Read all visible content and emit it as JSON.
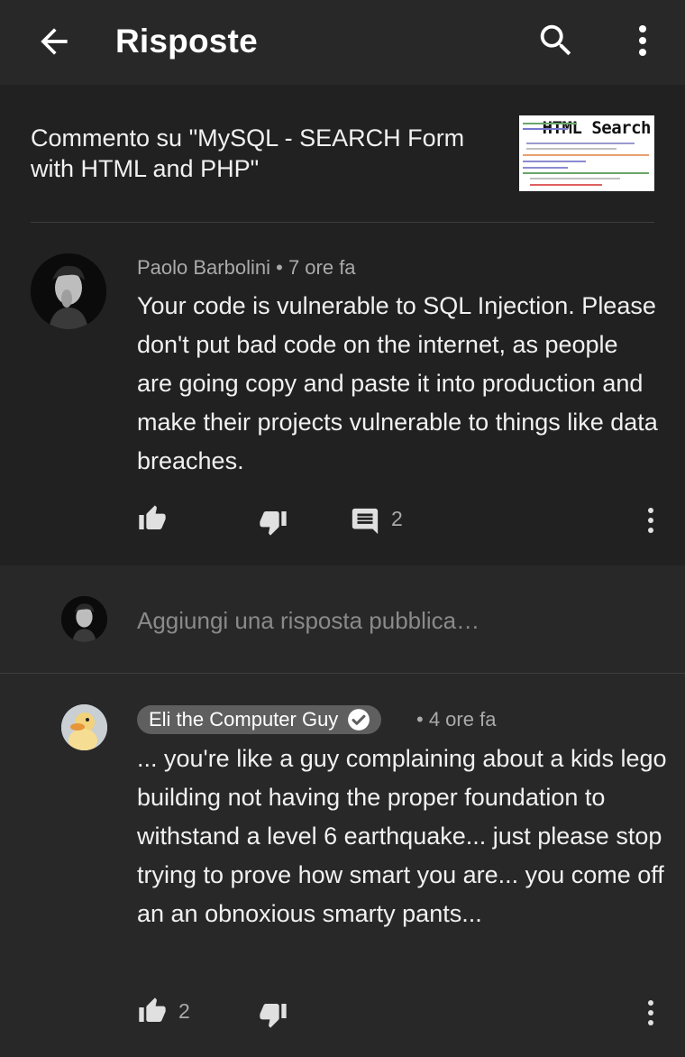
{
  "header": {
    "title": "Risposte",
    "icons": [
      "arrow-back-icon",
      "search-icon",
      "more-vert-icon"
    ]
  },
  "context": {
    "text": "Commento su \"MySQL - SEARCH Form with HTML and PHP\"",
    "thumbnail_text": "HTML Search"
  },
  "comment": {
    "author": "Paolo Barbolini",
    "separator": "•",
    "time": "7 ore fa",
    "text": "Your code is vulnerable to SQL Injection. Please don't put bad code on the internet, as people are going copy and paste it into production and make their projects vulnerable to things like data breaches.",
    "reply_count": "2"
  },
  "reply_input": {
    "placeholder": "Aggiungi una risposta pubblica…"
  },
  "reply": {
    "author": "Eli the Computer Guy",
    "separator": "•",
    "time": "4 ore fa",
    "text": "... you're like a guy complaining about a kids lego building not having the proper foundation to withstand a level 6 earthquake... just please stop trying to prove how smart you are... you come off an an obnoxious smarty pants...",
    "like_count": "2"
  },
  "colors": {
    "background": "#212121",
    "surface": "#282828",
    "secondary_text": "#aaaaaa",
    "chip": "#5f5f5f"
  }
}
